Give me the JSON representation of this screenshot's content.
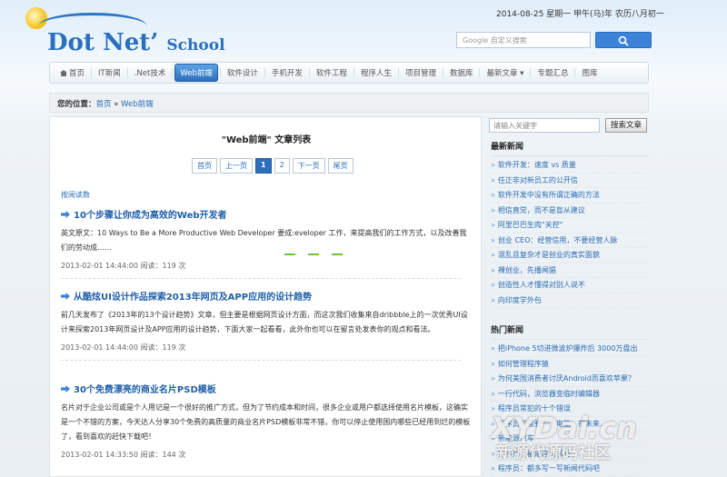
{
  "header": {
    "logo_main": "Dot Net",
    "logo_apos": "’",
    "logo_school": "School",
    "date_line": "2014-08-25 星期一 甲午(马)年 农历八月初一",
    "google_placeholder": "Google 自定义搜索"
  },
  "nav": {
    "items": [
      {
        "label": "首页"
      },
      {
        "label": "IT新闻"
      },
      {
        "label": ".Net技术"
      },
      {
        "label": "Web前端"
      },
      {
        "label": "软件设计"
      },
      {
        "label": "手机开发"
      },
      {
        "label": "软件工程"
      },
      {
        "label": "程序人生"
      },
      {
        "label": "项目管理"
      },
      {
        "label": "数据库"
      },
      {
        "label": "最新文章 ▾"
      },
      {
        "label": "专题汇总"
      },
      {
        "label": "图库"
      }
    ],
    "active_index": 3
  },
  "breadcrumb": {
    "label": "您的位置：",
    "home": "首页",
    "sep": " » ",
    "current": "Web前端"
  },
  "main": {
    "list_title": "\"Web前端\" 文章列表",
    "pager": [
      "首页",
      "上一页",
      "1",
      "2",
      "下一页",
      "尾页"
    ],
    "pager_current": 2,
    "sort_link": "按阅读数",
    "articles": [
      {
        "title": "10个步骤让你成为高效的Web开发者",
        "body": "英文原文：10 Ways to Be a More Productive Web Developer 要成:eveloper                                                      工作，来提高我们的工作方式，以及改善我们的劳动成……",
        "meta": "2013-02-01 14:44:00 阅读：119 次"
      },
      {
        "title": "从酷炫UI设计作品探索2013年网页及APP应用的设计趋势",
        "body": "前几天发布了《2013年的13个设计趋势》文章，但主要是根据网页设计方面，而这次我们收集来自dribbble上的一次优秀UI设计来探索2013年网页设计及APP应用的设计趋势，下面大家一起看看，此外你也可以在留言处发表你的观点和看法。",
        "meta": "2013-02-01 14:44:00 阅读：119 次"
      },
      {
        "title": "30个免费漂亮的商业名片PSD模板",
        "body": "名片对于企业公司或是个人用记是一个很好的推广方式，但为了节约成本和时间，很多企业或用户都选择使用名片模板，这确实是一个不错的方案，今天达人分享30个免费的高质量的商业名片PSD模板非常不错，你可以停止使用国内哪些已经用到烂的模板了，看到喜欢的赶快下载吧！",
        "meta": "2013-02-01 14:33:50 阅读：144 次"
      }
    ]
  },
  "sidebar": {
    "search_placeholder": "请输入关键字",
    "search_button": "搜索文章",
    "latest_title": "最新新闻",
    "latest": [
      "软件开发：速度 vs 质量",
      "任正非对新员工的公开信",
      "软件开发中没有所谓正确的方法",
      "相信直觉，而不是盲从建议",
      "阿里巴巴生肉\"关控\"",
      "创业 CEO：经营信用，不要经营人脉",
      "混乱且复杂才是创业的真实面貌",
      "裸创业，先播闻猖",
      "创造性人才懂得对别人说不",
      "向印度学外包"
    ],
    "hot_title": "热门新闻",
    "hot": [
      "把iPhone 5切进微波炉爆炸后 3000万盘出",
      "如何管理程序猿",
      "为何美国消费者讨厌Android而喜欢苹果？",
      "一行代码，浏览器变临时编辑器",
      "程序员常犯的十个错误",
      "程序员只需要一个电脑：在未来..",
      "新能源汽车",
      "程序员：都是这么想的",
      "程序员：都多写一写新闻代码吧"
    ]
  },
  "watermark": {
    "line1": "XYDai.cn",
    "line2": "新源代源码社区"
  }
}
